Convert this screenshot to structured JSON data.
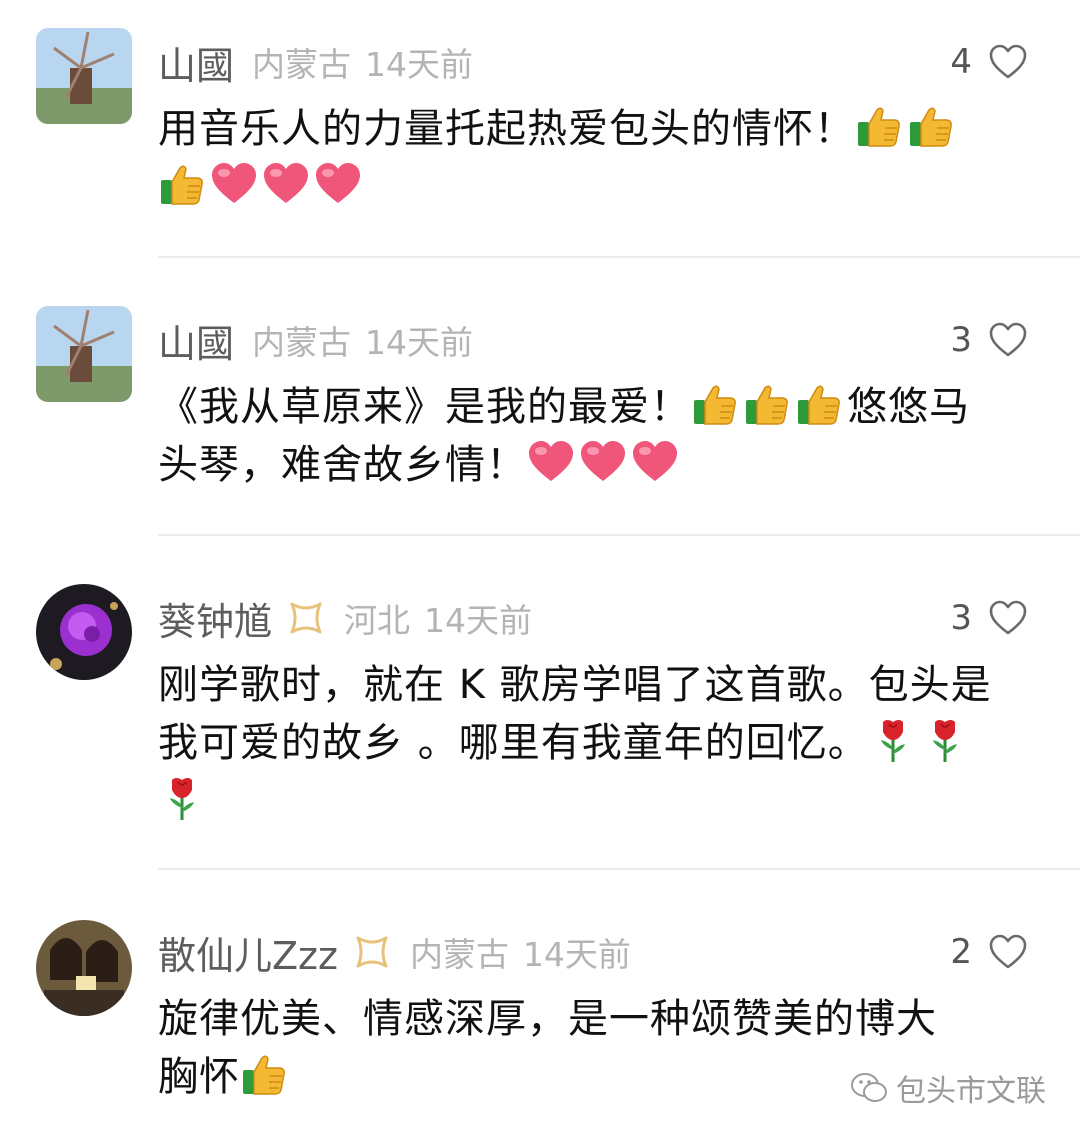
{
  "comments": [
    {
      "username": "山國",
      "location": "内蒙古",
      "time": "14天前",
      "likes": "4",
      "line1": "用音乐人的力量托起热爱包头的情怀！",
      "emoji_line1": [
        "thumbs-up",
        "thumbs-up"
      ],
      "emoji_line2": [
        "thumbs-up",
        "heart",
        "heart",
        "heart"
      ]
    },
    {
      "username": "山國",
      "location": "内蒙古",
      "time": "14天前",
      "likes": "3",
      "line1a": "《我从草原来》是我的最爱！",
      "line1b": "悠悠马",
      "line2": "头琴，难舍故乡情！",
      "emoji_line1": [
        "thumbs-up",
        "thumbs-up",
        "thumbs-up"
      ],
      "emoji_line2": [
        "heart",
        "heart",
        "heart"
      ]
    },
    {
      "username": "葵钟馗",
      "location": "河北",
      "time": "14天前",
      "likes": "3",
      "line1": "刚学歌时，就在 K 歌房学唱了这首歌。包头是",
      "line2": "我可爱的故乡 。哪里有我童年的回忆。",
      "emoji_line2": [
        "rose",
        "rose"
      ],
      "emoji_line3": [
        "rose"
      ]
    },
    {
      "username": "散仙儿Zzz",
      "location": "内蒙古",
      "time": "14天前",
      "likes": "2",
      "line1": "旋律优美、情感深厚，是一种颂赞美的博大",
      "line2": "胸怀",
      "emoji_line2": [
        "thumbs-up"
      ]
    }
  ],
  "watermark": {
    "text": "包头市文联",
    "icon": "wechat-icon"
  },
  "colors": {
    "username": "#5d5d5d",
    "meta": "#b4b4b4",
    "vip": "#e6c27a",
    "heart": "#f0557a"
  }
}
